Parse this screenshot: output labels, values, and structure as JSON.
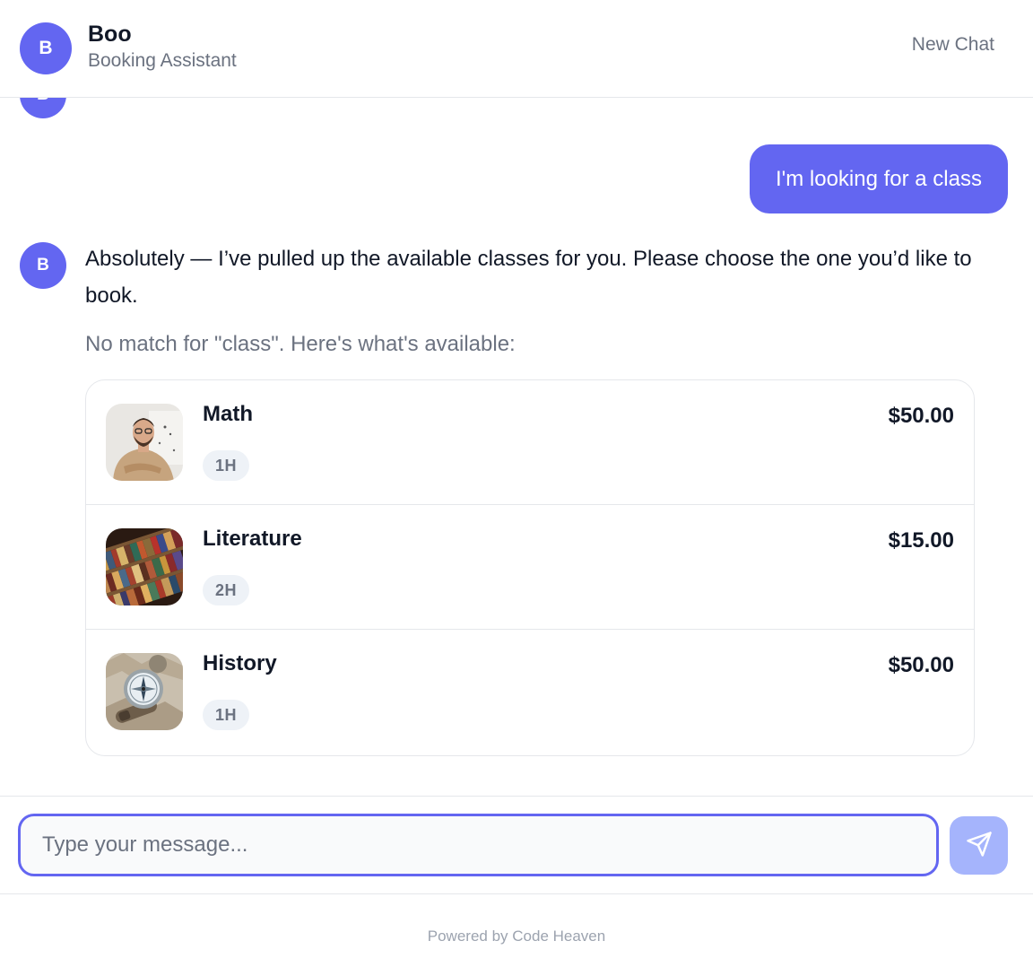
{
  "header": {
    "avatar_letter": "B",
    "title": "Boo",
    "subtitle": "Booking Assistant",
    "new_chat_label": "New Chat"
  },
  "messages": {
    "previous_bot_avatar_letter": "B",
    "user_message": "I'm looking for a class",
    "bot_avatar_letter": "B",
    "bot_message": "Absolutely — I’ve pulled up the available classes for you. Please choose the one you’d like to book.",
    "bot_note": "No match for \"class\". Here's what's available:"
  },
  "classes": [
    {
      "name": "Math",
      "duration": "1H",
      "price": "$50.00",
      "image": "man-portrait-photo"
    },
    {
      "name": "Literature",
      "duration": "2H",
      "price": "$15.00",
      "image": "bookshelf-photo"
    },
    {
      "name": "History",
      "duration": "1H",
      "price": "$50.00",
      "image": "compass-map-photo"
    }
  ],
  "input": {
    "placeholder": "Type your message...",
    "value": ""
  },
  "send_icon": "paper-plane-icon",
  "footer": {
    "text": "Powered by Code Heaven"
  },
  "colors": {
    "accent": "#6366f1",
    "send_disabled": "#a5b4fc",
    "muted_text": "#6b7280",
    "border": "#e5e7eb"
  }
}
